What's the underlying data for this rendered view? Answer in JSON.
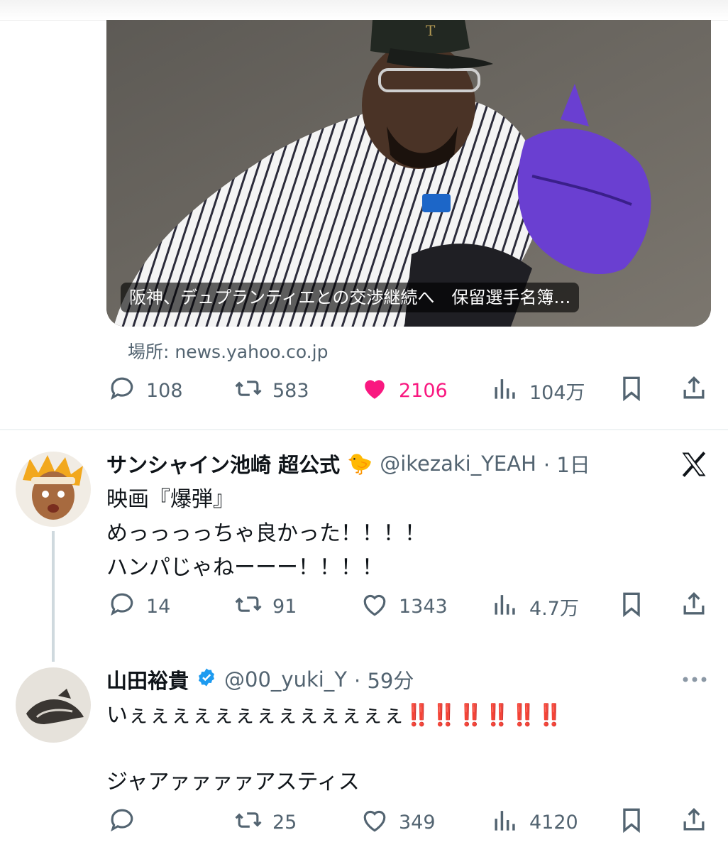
{
  "link_card": {
    "title": "阪神、デュプランティエとの交渉継続へ　保留選手名簿…",
    "source": "場所: news.yahoo.co.jp"
  },
  "tweet_top": {
    "actions": {
      "replies": "108",
      "retweets": "583",
      "likes": "2106",
      "views": "104万"
    },
    "liked": true
  },
  "tweet_1": {
    "name": "サンシャイン池崎 超公式",
    "name_emoji": "🐤",
    "handle": "@ikezaki_YEAH",
    "time": "· 1日",
    "lines": [
      "映画『爆弾』",
      "めっっっっちゃ良かった！！！！",
      "ハンパじゃねーーー！！！！"
    ],
    "actions": {
      "replies": "14",
      "retweets": "91",
      "likes": "1343",
      "views": "4.7万"
    }
  },
  "tweet_2": {
    "name": "山田裕貴",
    "verified": true,
    "handle": "@00_yuki_Y",
    "time": "· 59分",
    "line1_text": "いぇぇぇぇぇぇぇぇぇぇぇぇぇ",
    "line1_marks": "‼️‼️‼️‼️‼️‼️",
    "line2": "ジャアァァァァアスティス",
    "actions": {
      "replies": "",
      "retweets": "25",
      "likes": "349",
      "views": "4120"
    }
  },
  "colors": {
    "like_pink": "#f91880",
    "verified_blue": "#1d9bf0",
    "secondary": "#536471"
  }
}
